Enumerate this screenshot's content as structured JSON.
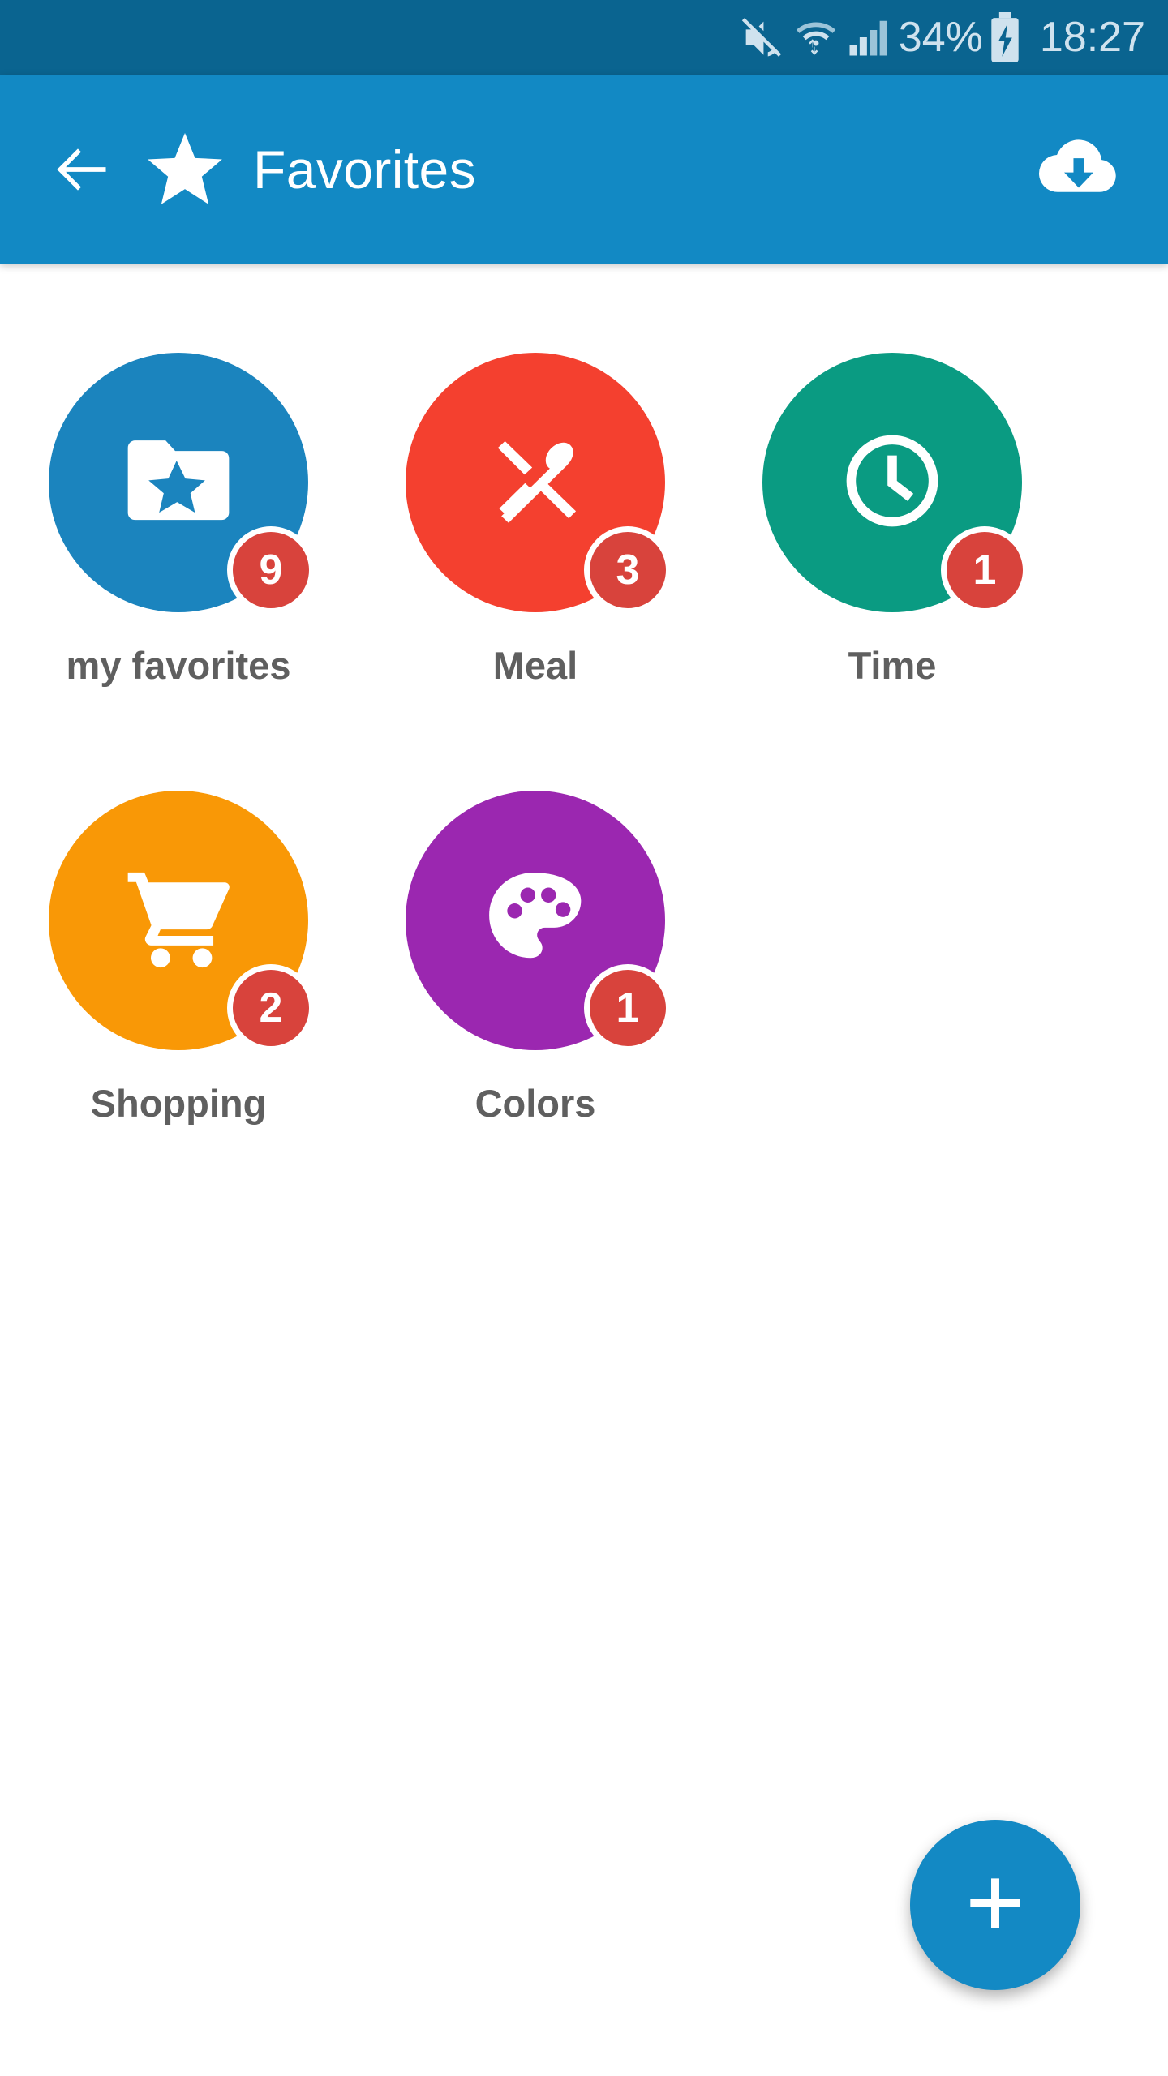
{
  "status_bar": {
    "background": "#0a6490",
    "text_color": "#cfe2ee",
    "icons": [
      "mute-icon",
      "wifi-icon",
      "signal-icon",
      "battery-charging-icon"
    ],
    "battery_percent": "34%",
    "time": "18:27"
  },
  "app_bar": {
    "background": "#1289c4",
    "back_icon": "back-arrow-icon",
    "logo_icon": "star-icon",
    "title": "Favorites",
    "action_icon": "cloud-download-icon"
  },
  "grid": {
    "items": [
      {
        "label": "my favorites",
        "badge": "9",
        "color": "#1b84be",
        "icon": "folder-star-icon"
      },
      {
        "label": "Meal",
        "badge": "3",
        "color": "#f4402f",
        "icon": "knife-spoon-icon"
      },
      {
        "label": "Time",
        "badge": "1",
        "color": "#0a9b82",
        "icon": "clock-icon"
      },
      {
        "label": "Shopping",
        "badge": "2",
        "color": "#f99806",
        "icon": "shopping-cart-icon"
      },
      {
        "label": "Colors",
        "badge": "1",
        "color": "#9b27b0",
        "icon": "palette-icon"
      }
    ],
    "badge_color": "#d8433c",
    "label_color": "#5f5f5f"
  },
  "fab": {
    "icon": "plus-icon",
    "color": "#1389c4"
  }
}
